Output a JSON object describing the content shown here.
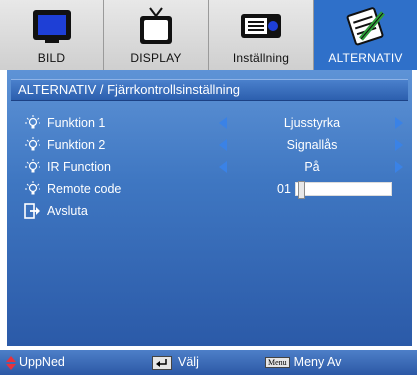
{
  "tabs": [
    {
      "label": "BILD",
      "icon": "monitor-icon",
      "active": false
    },
    {
      "label": "DISPLAY",
      "icon": "tv-icon",
      "active": false
    },
    {
      "label": "Inställning",
      "icon": "projector-icon",
      "active": false
    },
    {
      "label": "ALTERNATIV",
      "icon": "notepad-pen-icon",
      "active": true
    }
  ],
  "title": "ALTERNATIV / Fjärrkontrollsinställning",
  "rows": [
    {
      "label": "Funktion 1",
      "value": "Ljusstyrka",
      "icon": "bulb-icon"
    },
    {
      "label": "Funktion 2",
      "value": "Signallås",
      "icon": "bulb-icon"
    },
    {
      "label": "IR Function",
      "value": "På",
      "icon": "bulb-icon"
    },
    {
      "label": "Remote code",
      "value": "01",
      "slider_fraction": 0.01,
      "icon": "bulb-icon"
    }
  ],
  "exit": {
    "label": "Avsluta",
    "icon": "exit-icon"
  },
  "footer": {
    "updown": "UppNed",
    "select": "Välj",
    "menu_key": "Menu",
    "menu_off": "Meny Av"
  },
  "colors": {
    "accent": "#2f70c9",
    "arrow": "#3a82e6",
    "updown": "#e8323c"
  }
}
